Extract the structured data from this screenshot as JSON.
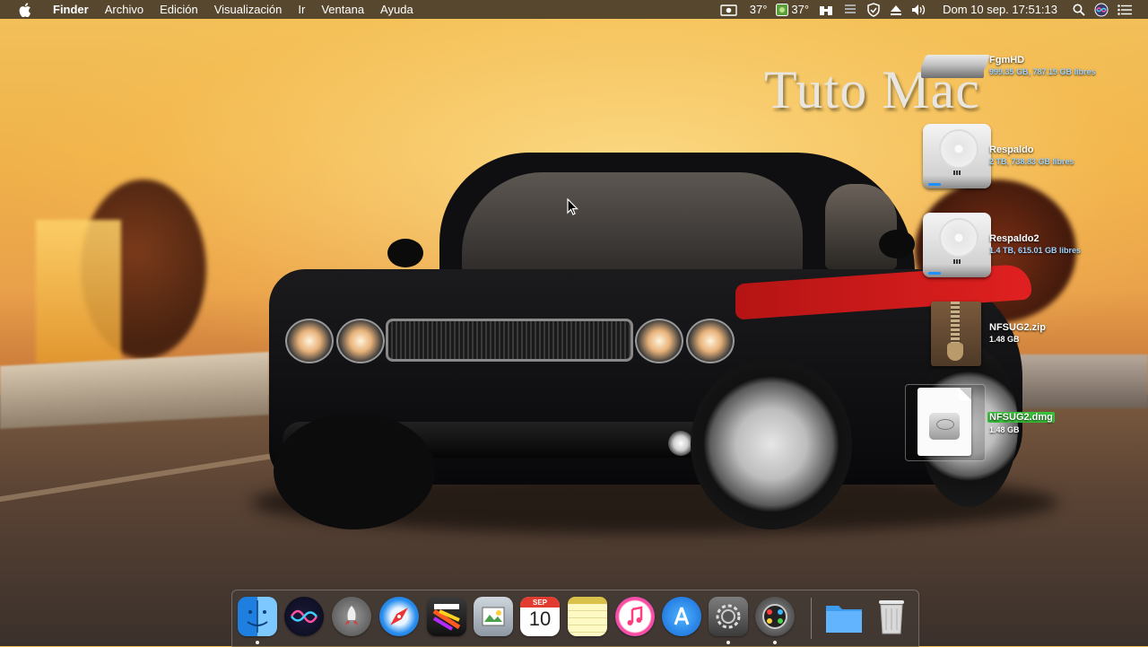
{
  "menubar": {
    "apple_icon": "apple-icon",
    "app_name": "Finder",
    "items": [
      "Archivo",
      "Edición",
      "Visualización",
      "Ir",
      "Ventana",
      "Ayuda"
    ],
    "status": {
      "cpu_temp": "37°",
      "gpu_temp": "37°",
      "clock": "Dom 10 sep.  17:51:13",
      "icons": [
        "screen-record-icon",
        "temperature-icon",
        "gpu-icon",
        "binoculars-icon",
        "stack-icon",
        "shield-icon",
        "eject-icon",
        "volume-icon",
        "spotlight-icon",
        "siri-icon",
        "notification-center-icon"
      ]
    }
  },
  "watermark": "Tuto Mac",
  "desktop": {
    "items": [
      {
        "name": "FgmHD",
        "info": "999.35 GB, 787.19 GB libres",
        "icon": "external-drive-icon"
      },
      {
        "name": "Respaldo",
        "info": "2 TB, 738.83 GB libres",
        "icon": "hard-drive-icon"
      },
      {
        "name": "Respaldo2",
        "info": "1.4 TB, 615.01 GB libres",
        "icon": "hard-drive-icon"
      },
      {
        "name": "NFSUG2.zip",
        "info": "1.48 GB",
        "icon": "zip-archive-icon"
      },
      {
        "name": "NFSUG2.dmg",
        "info": "1.48 GB",
        "icon": "disk-image-icon",
        "selected": true
      }
    ]
  },
  "dock": {
    "apps": [
      "finder-icon",
      "siri-icon",
      "launchpad-icon",
      "safari-icon",
      "final-cut-pro-icon",
      "preview-icon",
      "calendar-icon",
      "notes-icon",
      "itunes-icon",
      "app-store-icon",
      "system-preferences-icon",
      "photo-booth-icon"
    ],
    "calendar": {
      "month": "SEP",
      "day": "10"
    },
    "right_items": [
      "downloads-folder-icon",
      "trash-icon"
    ]
  }
}
